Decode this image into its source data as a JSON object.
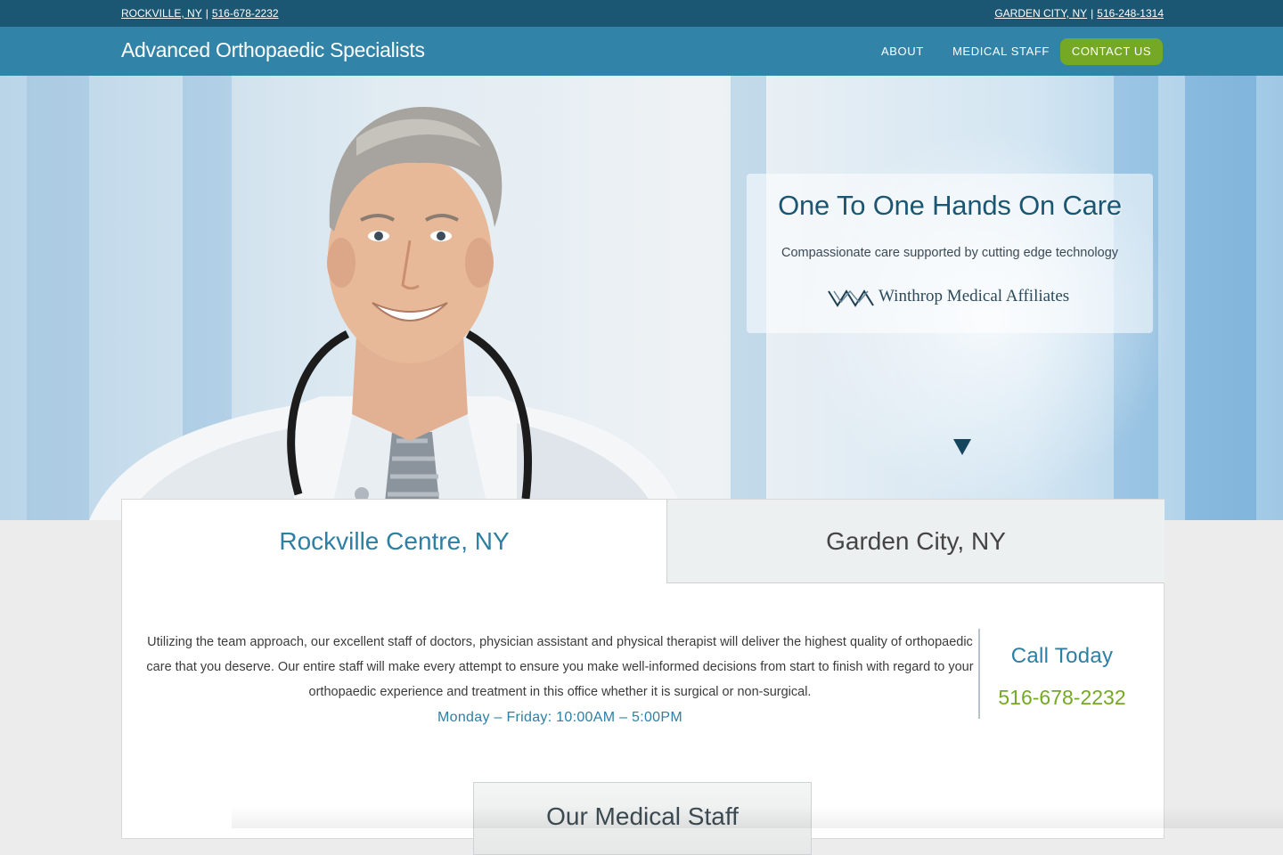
{
  "topbar": {
    "left_city": "ROCKVILLE, NY",
    "left_phone": "516-678-2232",
    "right_city": "GARDEN CITY, NY",
    "right_phone": "516-248-1314",
    "separator": "|"
  },
  "nav": {
    "brand": "Advanced Orthopaedic Specialists",
    "items": [
      {
        "label": "ABOUT"
      },
      {
        "label": "MEDICAL STAFF"
      },
      {
        "label": "CONTACT US"
      }
    ]
  },
  "hero": {
    "title": "One To One Hands On Care",
    "subtitle": "Compassionate care supported by cutting edge technology",
    "logo_text": "Winthrop Medical Affiliates",
    "scroll_icon": "triangle-down-icon"
  },
  "locations": {
    "tabs": [
      {
        "label": "Rockville Centre, NY",
        "active": true
      },
      {
        "label": "Garden City, NY",
        "active": false
      }
    ],
    "description": "Utilizing the team approach, our excellent staff of doctors, physician assistant and physical therapist will deliver the highest quality of orthopaedic care that you deserve. Our entire staff will make every attempt to ensure you make well-informed decisions from start to finish with regard to your orthopaedic experience and treatment in this office whether it is surgical or non-surgical.",
    "hours": "Monday – Friday: 10:00AM – 5:00PM",
    "call_label": "Call Today",
    "call_number": "516-678-2232"
  },
  "staff_section": {
    "title": "Our Medical Staff"
  },
  "colors": {
    "topbar": "#1b5672",
    "navbar": "#3283a8",
    "accent_green": "#74a825",
    "accent_blue": "#2e7fa3"
  }
}
